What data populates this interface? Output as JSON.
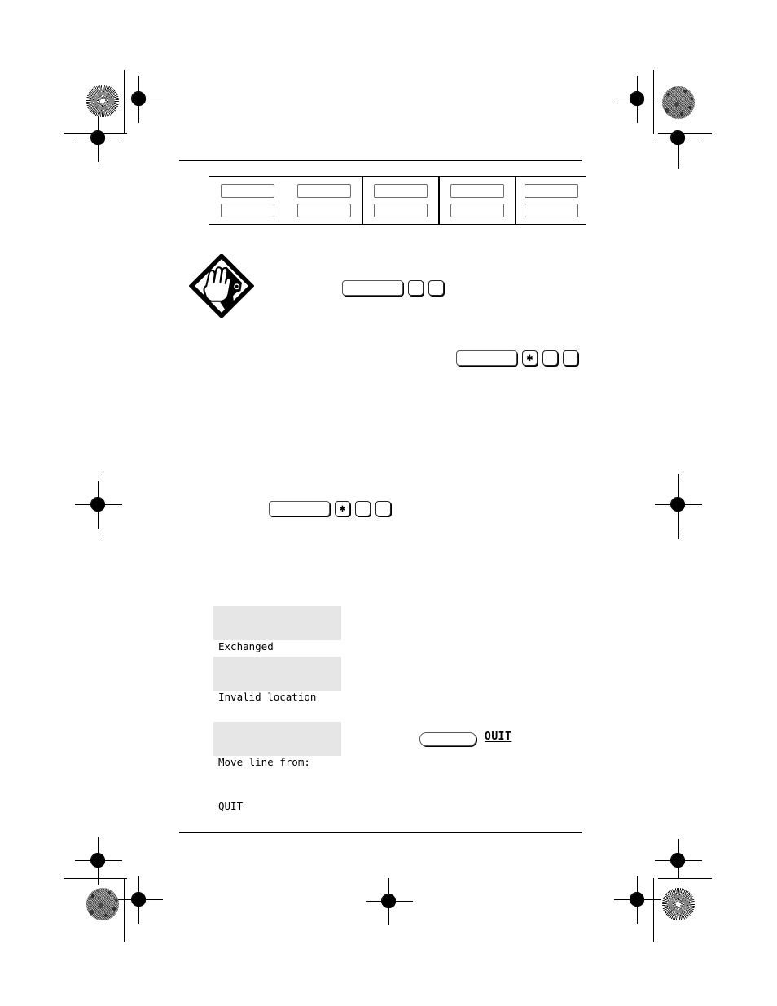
{
  "document": {
    "kind": "printed-manual-page",
    "page_background": "#ffffff"
  },
  "press_marks": {
    "registration_targets_label": "registration-target",
    "star_target_label": "star-burst-moire-target",
    "grain_target_label": "dot-gain-grain-target",
    "trim_line_label": "trim-line"
  },
  "header_rule": {
    "present": true
  },
  "footer_rule": {
    "present": true
  },
  "feature_table": {
    "columns": [
      {
        "boxes": [
          "",
          ""
        ]
      },
      {
        "boxes": [
          "",
          ""
        ]
      },
      {
        "boxes": [
          "",
          ""
        ],
        "emphasis": true
      },
      {
        "boxes": [
          "",
          ""
        ]
      },
      {
        "boxes": [
          "",
          ""
        ]
      }
    ]
  },
  "tips": {
    "icon_name": "tips-listening-diamond-icon",
    "alt": "Tips diamond icon: hand cupped to ear"
  },
  "key_sequences": [
    {
      "id": "seq-1",
      "keys": [
        {
          "type": "wide",
          "label": ""
        },
        {
          "type": "square",
          "label": ""
        },
        {
          "type": "square",
          "label": ""
        }
      ]
    },
    {
      "id": "seq-2",
      "keys": [
        {
          "type": "wide",
          "label": ""
        },
        {
          "type": "square",
          "label": "✱"
        },
        {
          "type": "square",
          "label": ""
        },
        {
          "type": "square",
          "label": ""
        }
      ]
    },
    {
      "id": "seq-3",
      "keys": [
        {
          "type": "wide",
          "label": ""
        },
        {
          "type": "square",
          "label": "✱"
        },
        {
          "type": "square",
          "label": ""
        },
        {
          "type": "square",
          "label": ""
        }
      ]
    }
  ],
  "displays": {
    "exchanged": {
      "line1": "Exchanged",
      "line2": ""
    },
    "invalid_location": {
      "line1": "Invalid location",
      "line2": ""
    },
    "move_line_from": {
      "line1": "Move line from:",
      "line2": "QUIT"
    }
  },
  "softkey": {
    "key_label": "",
    "display_label": "QUIT"
  },
  "colors": {
    "lcd_background": "#e6e6e6",
    "ink": "#000000",
    "box_stroke": "#6d6d6d"
  }
}
